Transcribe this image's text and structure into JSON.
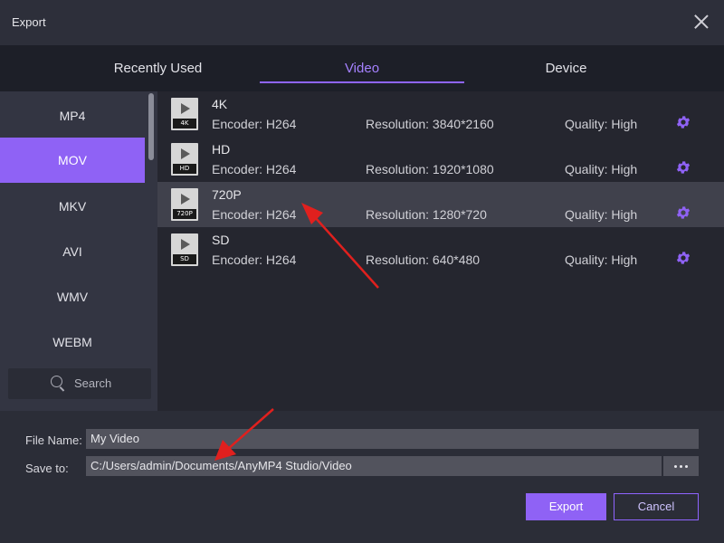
{
  "window": {
    "title": "Export"
  },
  "tabs": [
    {
      "label": "Recently Used"
    },
    {
      "label": "Video"
    },
    {
      "label": "Device"
    }
  ],
  "formats": [
    {
      "label": "MP4"
    },
    {
      "label": "MOV"
    },
    {
      "label": "MKV"
    },
    {
      "label": "AVI"
    },
    {
      "label": "WMV"
    },
    {
      "label": "WEBM"
    }
  ],
  "search": {
    "label": "Search"
  },
  "presets": [
    {
      "name": "4K",
      "badge": "4K",
      "encoder": "Encoder: H264",
      "resolution": "Resolution: 3840*2160",
      "quality": "Quality: High"
    },
    {
      "name": "HD",
      "badge": "HD",
      "encoder": "Encoder: H264",
      "resolution": "Resolution: 1920*1080",
      "quality": "Quality: High"
    },
    {
      "name": "720P",
      "badge": "720P",
      "encoder": "Encoder: H264",
      "resolution": "Resolution: 1280*720",
      "quality": "Quality: High"
    },
    {
      "name": "SD",
      "badge": "SD",
      "encoder": "Encoder: H264",
      "resolution": "Resolution: 640*480",
      "quality": "Quality: High"
    }
  ],
  "output": {
    "file_name_label": "File Name:",
    "file_name_value": "My Video",
    "save_to_label": "Save to:",
    "save_to_value": "C:/Users/admin/Documents/AnyMP4 Studio/Video"
  },
  "buttons": {
    "export": "Export",
    "cancel": "Cancel"
  },
  "colors": {
    "accent": "#8f62f5",
    "annotation": "#e0201e"
  }
}
